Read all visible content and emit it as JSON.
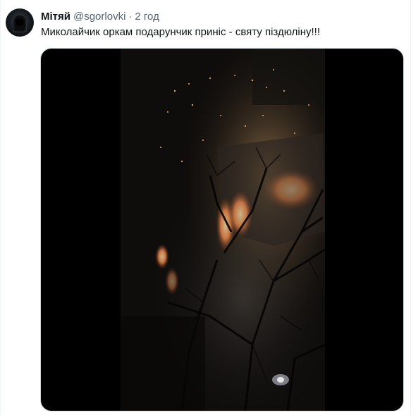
{
  "tweet": {
    "author_name": "Мітяй",
    "author_handle": "@sgorlovki",
    "separator": "·",
    "time": "2 год",
    "text": "Миколайчик оркам подарунчик приніс - святу піздюліну!!!"
  },
  "media": {
    "type": "video",
    "description_icon": "video-frame"
  },
  "icons": {
    "avatar": "hooded-figure-avatar"
  }
}
